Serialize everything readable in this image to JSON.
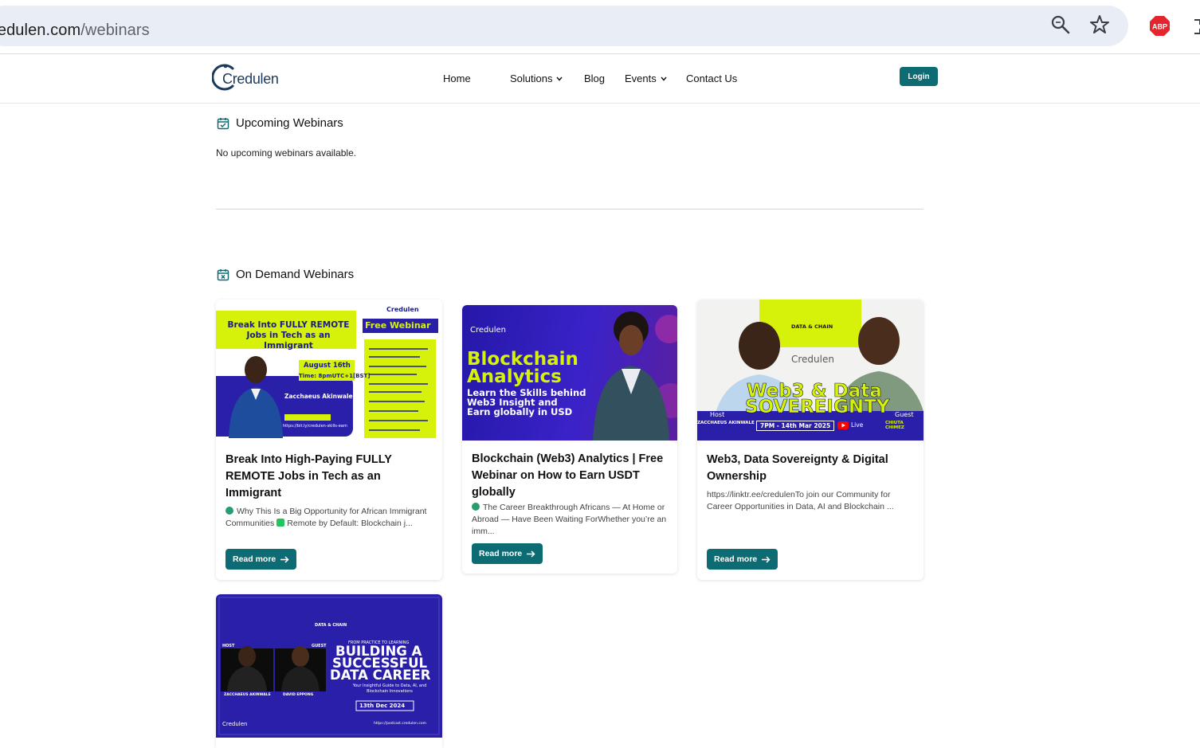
{
  "browser": {
    "url_prefix": "credulen.com",
    "url_path": "/webinars"
  },
  "header": {
    "logo_text": "Credulen",
    "nav": {
      "home": "Home",
      "solutions": "Solutions",
      "blog": "Blog",
      "events": "Events",
      "contact": "Contact Us"
    },
    "login": "Login"
  },
  "upcoming": {
    "title": "Upcoming Webinars",
    "empty_text": "No upcoming webinars available."
  },
  "on_demand": {
    "title": "On Demand Webinars",
    "read_more": "Read more",
    "cards": [
      {
        "title": "Break Into High-Paying FULLY REMOTE Jobs in Tech as an Immigrant",
        "excerpt_a": "Why This Is a Big Opportunity for African Immigrant Communities",
        "excerpt_b": "Remote by Default: Blockchain j...",
        "banner": {
          "headline": "Break Into FULLY REMOTE Jobs in Tech as an Immigrant",
          "tag": "Free Webinar",
          "brand": "Credulen",
          "date": "August 16th",
          "time": "Time: 8pmUTC+1[BST]",
          "speaker": "Zacchaeus Akinwale",
          "register": "https://bit.ly/credulen-skills-earn"
        }
      },
      {
        "title": "Blockchain (Web3) Analytics | Free Webinar on How to Earn USDT globally",
        "excerpt": "The Career Breakthrough Africans — At Home or Abroad — Have Been Waiting ForWhether you’re an imm...",
        "banner": {
          "brand": "Credulen",
          "headline1": "Blockchain",
          "headline2": "Analytics",
          "sub1": "Learn the Skills behind",
          "sub2": "Web3 Insight and",
          "sub3": "Earn globally in USD"
        }
      },
      {
        "title": "Web3, Data Sovereignty & Digital Ownership",
        "excerpt": "https://linktr.ee/credulenTo join our Community for Career Opportunities in Data, AI and Blockchain ...",
        "banner": {
          "podcast": "DATA & CHAIN",
          "brand": "Credulen",
          "headline1": "Web3 & Data",
          "headline2": "SOVEREIGNTY",
          "host": "Host",
          "host_name": "ZACCHAEUS AKINWALE",
          "guest": "Guest",
          "guest_name": "CHIUTA CHIMEZ",
          "datetime": "7PM - 14th Mar 2025",
          "live": "Live"
        }
      },
      {
        "banner": {
          "podcast": "DATA & CHAIN",
          "kicker": "FROM PRACTICE TO LEARNING",
          "headline1": "BUILDING A",
          "headline2": "SUCCESSFUL",
          "headline3": "DATA CAREER",
          "sub": "Your Insightful Guide to Data, AI, and Blockchain Innovations",
          "date": "13th Dec 2024",
          "host": "HOST",
          "host_name": "ZACCHAEUS AKINWALE",
          "guest": "GUEST",
          "guest_name": "DAVID EPPONG",
          "brand": "Credulen",
          "url": "https://podcast.credulen.com"
        }
      }
    ]
  },
  "colors": {
    "brand_teal": "#0d6b73",
    "banner_lime": "#d6f20a",
    "banner_blue": "#2a1fa8"
  }
}
